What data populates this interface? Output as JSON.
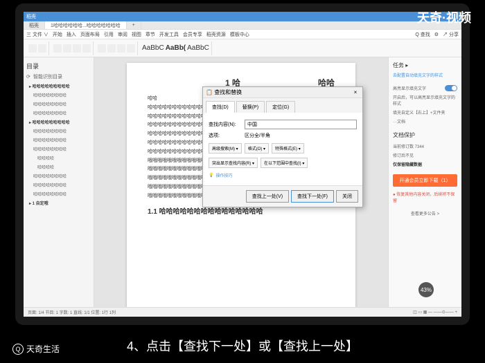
{
  "watermark": "天奇·视频",
  "titlebar": {
    "app": "稻壳"
  },
  "window_tabs": [
    {
      "label": "稻壳"
    },
    {
      "label": "1哈哈哈哈哈哈...哈哈哈哈哈哈哈"
    }
  ],
  "menu": [
    "三 文件 ∨",
    "开始",
    "插入",
    "页面布局",
    "引用",
    "审阅",
    "视图",
    "章节",
    "开发工具",
    "会员专享",
    "稻壳资源",
    "模板中心"
  ],
  "menu_right": [
    "Q 查找",
    "⚙",
    "↗ 分享"
  ],
  "toolbar": {
    "file_menu": "三 文件 ∨",
    "font_samples": [
      "AaBbC",
      "AaBb(",
      "AaBbC"
    ]
  },
  "sidebar_left": {
    "title": "目录",
    "subtitle": "智能识别目录",
    "items": [
      {
        "level": 1,
        "text": "哈哈哈哈哈哈哈哈哈"
      },
      {
        "level": 2,
        "text": "哈哈哈哈哈哈哈哈"
      },
      {
        "level": 2,
        "text": "哈哈哈哈哈哈哈哈"
      },
      {
        "level": 2,
        "text": "哈哈哈哈哈哈哈哈"
      },
      {
        "level": 1,
        "text": "哈哈哈哈哈哈哈哈哈"
      },
      {
        "level": 2,
        "text": "哈哈哈哈哈哈哈哈"
      },
      {
        "level": 2,
        "text": "哈哈哈哈哈哈哈哈"
      },
      {
        "level": 2,
        "text": "哈哈哈哈哈哈哈哈"
      },
      {
        "level": 3,
        "text": "哈哈哈哈"
      },
      {
        "level": 3,
        "text": "哈哈哈哈"
      },
      {
        "level": 2,
        "text": "哈哈哈哈哈哈哈哈"
      },
      {
        "level": 2,
        "text": "哈哈哈哈哈哈哈哈"
      },
      {
        "level": 2,
        "text": "哈哈哈哈哈哈哈哈"
      },
      {
        "level": 1,
        "text": "1 自定哦"
      }
    ]
  },
  "document": {
    "h1": "1 哈",
    "h1_right": "哈哈",
    "paras": [
      "哈哈",
      "哈哈哈哈哈哈哈哈哈哈哈哈哈",
      "哈哈哈哈哈哈哈哈哈哈哈哈哈",
      "哈哈哈哈哈哈哈哈哈哈哈哈哈",
      "哈哈哈哈哈哈哈哈哈哈哈哈哈"
    ],
    "rows": [
      "哈哈哈哈哈哈哈哈哈哈哈哈哈哈",
      "哈哈哈哈哈哈哈哈哈哈哈哈哈哈 ∑4∗",
      "哦哦哦哦哦哦哦哦哦哦哦哦哦哦",
      "哦哦哦哦哦哦哦哦哦哦哦哦哦哦",
      "哦哦哦哦哦哦哦哦哦哦哦哦哦哦",
      "哦哦哦哦哦哦哦哦哦哦哦哦哦哦",
      "哦哦哦哦哦哦哦哦哦哦哦哦哦哦"
    ],
    "h2": "1.1 哈哈哈哈哈哈哈哈哈哈哈哈哈哈哈"
  },
  "sidebar_right": {
    "title": "任务",
    "link1": "去配置自动填充文字的样式",
    "item1_label": "高亮显示填充文字",
    "item2": "开启后，可以高亮显示填充文字的样式",
    "item3": "填充自定义【右上】+文件夹",
    "item4": "···文档",
    "section2": "文档保护",
    "sec2_item1": "当前修订数 7344",
    "sec2_item2": "修订后不见",
    "sec2_item3": "仅保留隐藏数据",
    "orange_btn": "开通会员立即下载（1）",
    "footer_text": "恢复其他内容关闭，后续将不保留",
    "footer_link": "查看更多公告 >"
  },
  "dialog": {
    "title": "查找和替换",
    "tabs": [
      "查找(D)",
      "替换(P)",
      "定位(G)"
    ],
    "find_label": "查找内容(N):",
    "find_value": "中国",
    "options_label": "选项:",
    "options_value": "区分全/半角",
    "advanced": "高级搜索(M) ▾",
    "format": "格式(O) ▾",
    "special": "特殊格式(E) ▾",
    "highlight": "突出显示查找内容(R) ▾",
    "reading": "在以下范围中查找(I) ▾",
    "op_tip": "操作技巧",
    "btn_prev": "查找上一处(V)",
    "btn_next": "查找下一处(F)",
    "btn_close": "关闭"
  },
  "statusbar": {
    "left": "页面: 1/4  节目: 1  字数: 1  直线: 1/1  位置: 1行 1列"
  },
  "badge": "43%",
  "caption": "4、点击【查找下一处】或【查找上一处】",
  "brand": "天奇生活"
}
